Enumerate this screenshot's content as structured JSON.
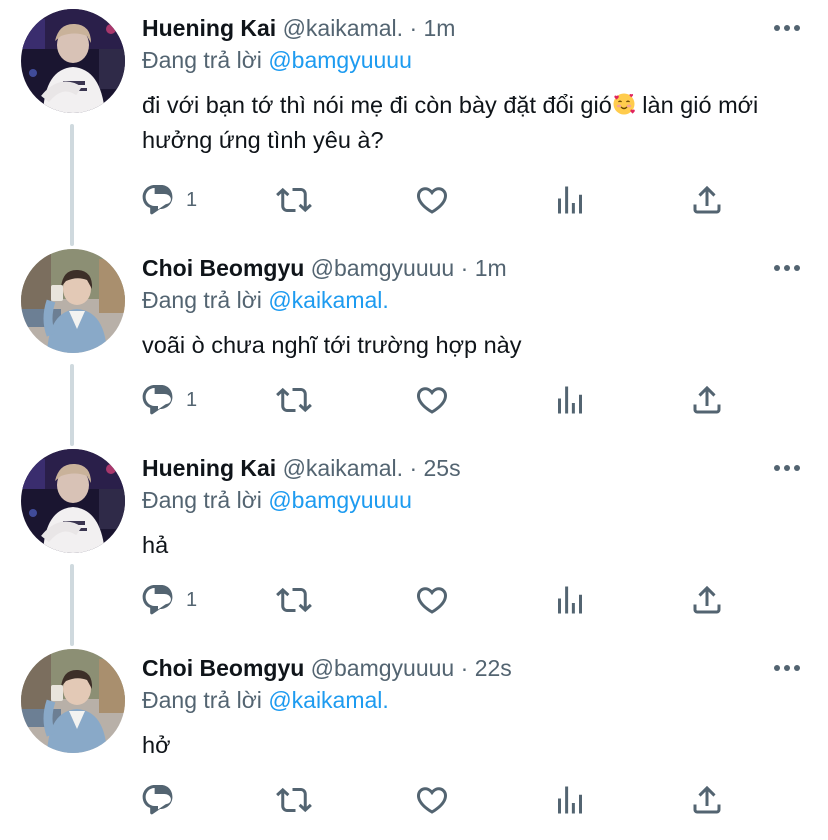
{
  "colors": {
    "text": "#0f1419",
    "secondary": "#536471",
    "accent": "#1d9bf0",
    "thread_line": "#cfd9de"
  },
  "tweets": [
    {
      "name": "Huening Kai",
      "handle": "@kaikamal.",
      "separator": "·",
      "time": "1m",
      "reply_prefix": "Đang trả lời",
      "reply_to": "@bamgyuuuu",
      "text_before_emoji": "đi với bạn tớ thì nói mẹ đi còn bày đặt đổi gió",
      "emoji": "smiling-face-with-hearts",
      "text_after_emoji": " làn gió mới hưởng ứng tình yêu à?",
      "reply_count": "1",
      "icons": [
        "reply-icon",
        "retweet-icon",
        "like-icon",
        "analytics-icon",
        "share-icon"
      ]
    },
    {
      "name": "Choi Beomgyu",
      "handle": "@bamgyuuuu",
      "separator": "·",
      "time": "1m",
      "reply_prefix": "Đang trả lời",
      "reply_to": "@kaikamal.",
      "text": "voãi ò chưa nghĩ tới trường hợp này",
      "reply_count": "1",
      "icons": [
        "reply-icon",
        "retweet-icon",
        "like-icon",
        "analytics-icon",
        "share-icon"
      ]
    },
    {
      "name": "Huening Kai",
      "handle": "@kaikamal.",
      "separator": "·",
      "time": "25s",
      "reply_prefix": "Đang trả lời",
      "reply_to": "@bamgyuuuu",
      "text": "hả",
      "reply_count": "1",
      "icons": [
        "reply-icon",
        "retweet-icon",
        "like-icon",
        "analytics-icon",
        "share-icon"
      ]
    },
    {
      "name": "Choi Beomgyu",
      "handle": "@bamgyuuuu",
      "separator": "·",
      "time": "22s",
      "reply_prefix": "Đang trả lời",
      "reply_to": "@kaikamal.",
      "text": "hở",
      "reply_count": "",
      "icons": [
        "reply-icon",
        "retweet-icon",
        "like-icon",
        "analytics-icon",
        "share-icon"
      ]
    }
  ]
}
